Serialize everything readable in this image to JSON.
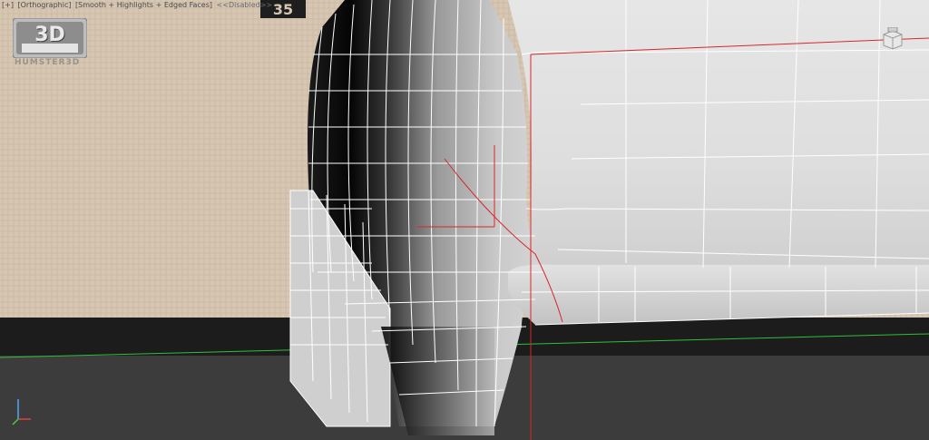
{
  "viewport": {
    "label_items": [
      "[+]",
      "[Orthographic]",
      "[Smooth + Highlights + Edged Faces]",
      "<<Disabled>>"
    ],
    "watermark_text": "HUMSTER3D",
    "logo_text": "3D",
    "wall_sign_text": "35"
  },
  "colors": {
    "wall": "#d6c6b2",
    "floor": "#3c3c3c",
    "baseboard": "#1c1c1c",
    "mesh_shade_light": "#d9d9d9",
    "mesh_shade_dark": "#050505",
    "wireframe": "#ffffff",
    "grid_line": "#2fbf3a",
    "bounding_red": "#d8262d"
  },
  "icons": {
    "viewcube": "viewcube-icon",
    "axis_gizmo": "axis-tripod-icon"
  }
}
